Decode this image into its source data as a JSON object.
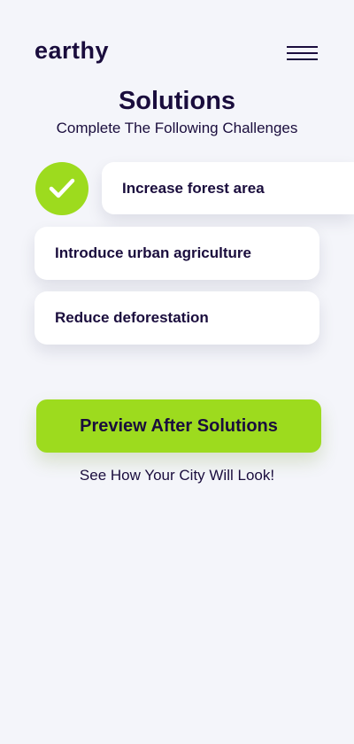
{
  "header": {
    "logo_text": "earthy",
    "menu_icon": "hamburger-menu-icon"
  },
  "main": {
    "title": "Solutions",
    "subtitle": "Complete The Following Challenges",
    "challenges": [
      {
        "label": "Increase forest area",
        "completed": true
      },
      {
        "label": "Introduce urban agriculture",
        "completed": false
      },
      {
        "label": "Reduce deforestation",
        "completed": false
      }
    ],
    "preview_button_label": "Preview After Solutions",
    "caption": "See How Your City Will Look!"
  },
  "colors": {
    "background": "#f4f5fa",
    "accent": "#9ddb1e",
    "text": "#1a0d3d",
    "card": "#ffffff"
  }
}
